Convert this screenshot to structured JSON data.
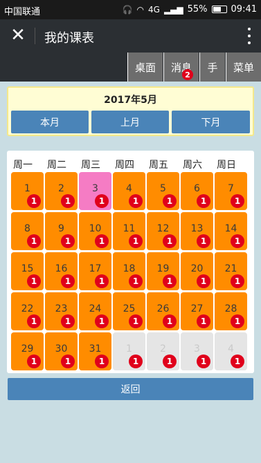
{
  "status": {
    "carrier": "中国联通",
    "net": "4G",
    "battery": "55%",
    "time": "09:41"
  },
  "appbar": {
    "title": "我的课表"
  },
  "nav": {
    "desktop": "桌面",
    "messages": "消息",
    "message_badge": "2",
    "hand": "手",
    "menu": "菜单"
  },
  "month": {
    "title": "2017年5月",
    "this_month": "本月",
    "prev_month": "上月",
    "next_month": "下月"
  },
  "weekdays": [
    "周一",
    "周二",
    "周三",
    "周四",
    "周五",
    "周六",
    "周日"
  ],
  "days": [
    {
      "n": "1",
      "badge": "1",
      "type": "cur"
    },
    {
      "n": "2",
      "badge": "1",
      "type": "cur"
    },
    {
      "n": "3",
      "badge": "1",
      "type": "today"
    },
    {
      "n": "4",
      "badge": "1",
      "type": "cur"
    },
    {
      "n": "5",
      "badge": "1",
      "type": "cur"
    },
    {
      "n": "6",
      "badge": "1",
      "type": "cur"
    },
    {
      "n": "7",
      "badge": "1",
      "type": "cur"
    },
    {
      "n": "8",
      "badge": "1",
      "type": "cur"
    },
    {
      "n": "9",
      "badge": "1",
      "type": "cur"
    },
    {
      "n": "10",
      "badge": "1",
      "type": "cur"
    },
    {
      "n": "11",
      "badge": "1",
      "type": "cur"
    },
    {
      "n": "12",
      "badge": "1",
      "type": "cur"
    },
    {
      "n": "13",
      "badge": "1",
      "type": "cur"
    },
    {
      "n": "14",
      "badge": "1",
      "type": "cur"
    },
    {
      "n": "15",
      "badge": "1",
      "type": "cur"
    },
    {
      "n": "16",
      "badge": "1",
      "type": "cur"
    },
    {
      "n": "17",
      "badge": "1",
      "type": "cur"
    },
    {
      "n": "18",
      "badge": "1",
      "type": "cur"
    },
    {
      "n": "19",
      "badge": "1",
      "type": "cur"
    },
    {
      "n": "20",
      "badge": "1",
      "type": "cur"
    },
    {
      "n": "21",
      "badge": "1",
      "type": "cur"
    },
    {
      "n": "22",
      "badge": "1",
      "type": "cur"
    },
    {
      "n": "23",
      "badge": "1",
      "type": "cur"
    },
    {
      "n": "24",
      "badge": "1",
      "type": "cur"
    },
    {
      "n": "25",
      "badge": "1",
      "type": "cur"
    },
    {
      "n": "26",
      "badge": "1",
      "type": "cur"
    },
    {
      "n": "27",
      "badge": "1",
      "type": "cur"
    },
    {
      "n": "28",
      "badge": "1",
      "type": "cur"
    },
    {
      "n": "29",
      "badge": "1",
      "type": "cur"
    },
    {
      "n": "30",
      "badge": "1",
      "type": "cur"
    },
    {
      "n": "31",
      "badge": "1",
      "type": "cur"
    },
    {
      "n": "1",
      "badge": "1",
      "type": "other"
    },
    {
      "n": "2",
      "badge": "1",
      "type": "other"
    },
    {
      "n": "3",
      "badge": "1",
      "type": "other"
    },
    {
      "n": "4",
      "badge": "1",
      "type": "other"
    }
  ],
  "back": "返回",
  "colors": {
    "accent": "#4a84b8",
    "cell": "#ff8c00",
    "today": "#f57cc4",
    "badge": "#e0001b"
  }
}
